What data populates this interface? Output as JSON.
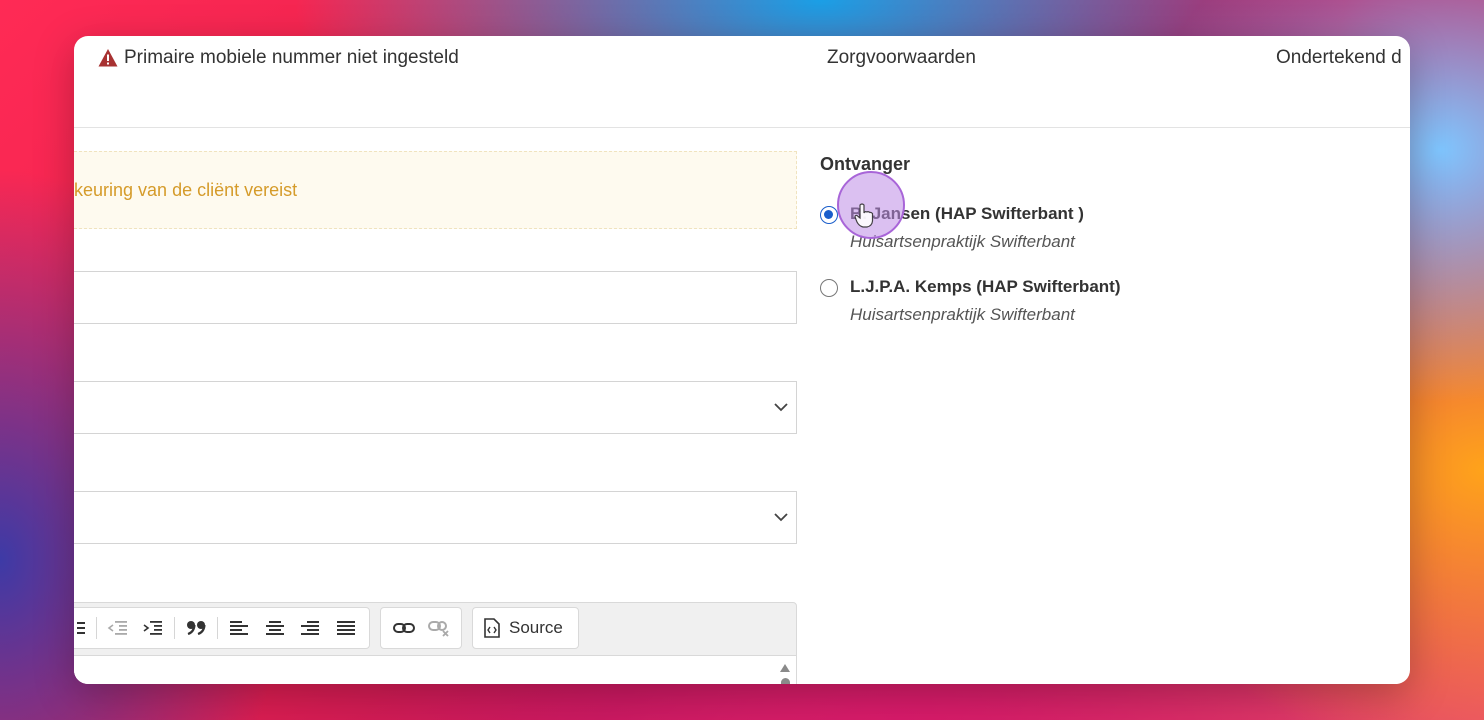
{
  "topbar": {
    "warning_text": "Primaire mobiele nummer niet ingesteld",
    "middle_text": "Zorgvoorwaarden",
    "right_text": "Ondertekend d"
  },
  "alert": {
    "text": "dkeuring van de cliënt vereist"
  },
  "editor": {
    "source_label": "Source"
  },
  "recipients": {
    "title": "Ontvanger",
    "items": [
      {
        "name": "B. Jansen (HAP Swifterbant )",
        "org": "Huisartsenpraktijk Swifterbant",
        "selected": true
      },
      {
        "name": "L.J.P.A. Kemps (HAP Swifterbant)",
        "org": "Huisartsenpraktijk Swifterbant",
        "selected": false
      }
    ]
  },
  "colors": {
    "warning_icon": "#a83232",
    "alert_text": "#d59b2a",
    "radio_selected": "#1a5ecb",
    "cursor_highlight": "#a865d8"
  },
  "icons": [
    "warning-triangle-icon",
    "chevron-down-icon",
    "indent-icon",
    "outdent-icon",
    "blockquote-icon",
    "align-left-icon",
    "align-center-icon",
    "align-right-icon",
    "align-justify-icon",
    "link-icon",
    "unlink-icon",
    "source-icon",
    "hand-cursor-icon"
  ]
}
